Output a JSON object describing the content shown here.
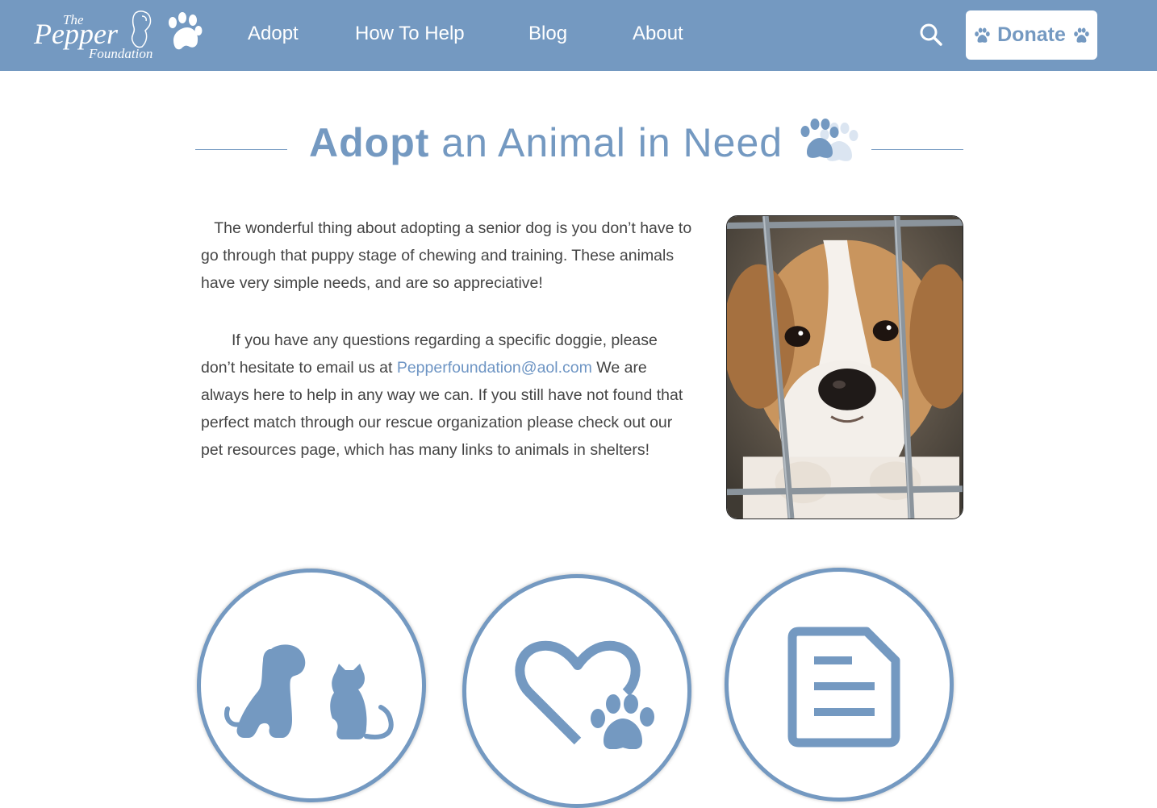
{
  "nav": {
    "logo": {
      "line1": "The",
      "line2": "Pepper",
      "line3": "Foundation"
    },
    "items": [
      {
        "label": "Adopt"
      },
      {
        "label": "How To Help"
      },
      {
        "label": "Blog"
      },
      {
        "label": "About"
      }
    ],
    "search_icon": "search-icon",
    "donate_label": "Donate"
  },
  "hero": {
    "title_bold": "Adopt",
    "title_rest": " an Animal in Need"
  },
  "content": {
    "p1": "The wonderful thing about adopting a senior dog is you don’t have to go through that puppy stage of chewing and training. These animals have very simple needs, and are so appreciative!",
    "p2_before": "If you have any questions regarding a specific doggie, please don’t hesitate to email us at ",
    "email": "Pepperfoundation@aol.com",
    "p2_after": " We are always here to help in any way we can. If you still have not found that perfect match through our rescue organization please check out our  pet resources page, which has many links to animals in shelters!"
  },
  "photo": {
    "icon": "dog-behind-cage-photo"
  },
  "circles": [
    {
      "icon": "dog-and-cat-icon"
    },
    {
      "icon": "heart-paw-icon"
    },
    {
      "icon": "document-icon"
    }
  ],
  "colors": {
    "brand": "#7499c1",
    "white": "#ffffff",
    "text": "#444444",
    "link": "#6e95c4"
  }
}
